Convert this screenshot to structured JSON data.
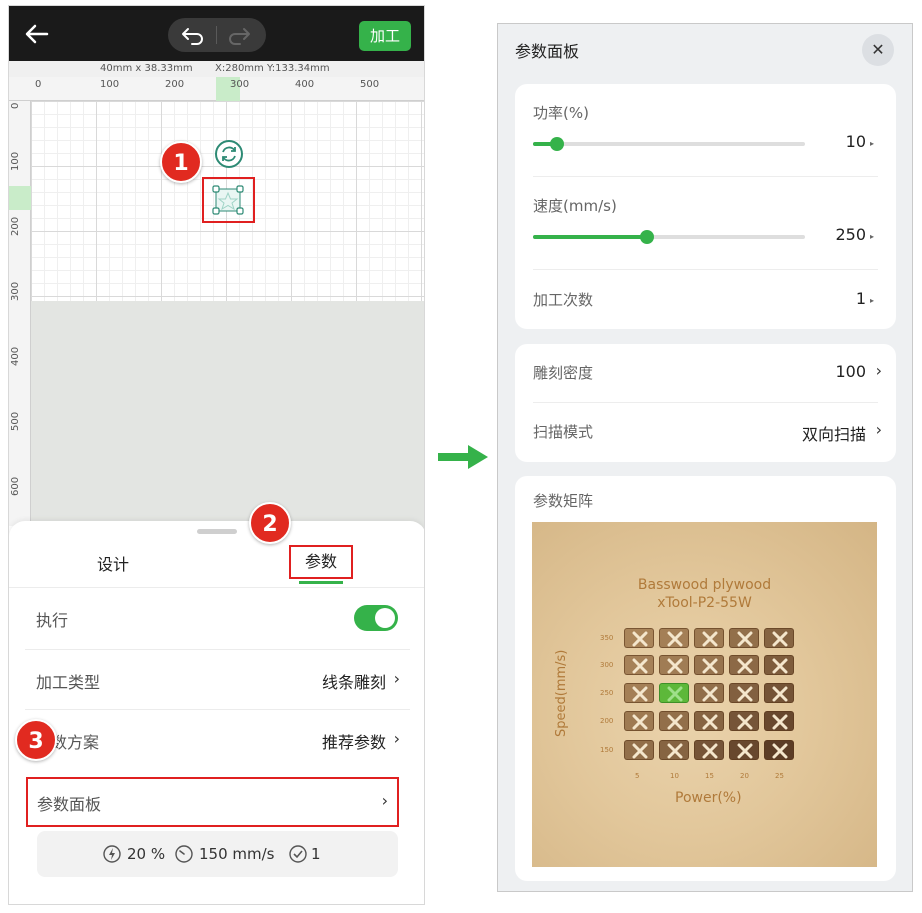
{
  "left": {
    "toolbar": {
      "process_label": "加工"
    },
    "dims": {
      "size": "40mm x 38.33mm",
      "pos": "X:280mm Y:133.34mm"
    },
    "ruler_top": [
      "0",
      "100",
      "200",
      "300",
      "400",
      "500"
    ],
    "ruler_left": [
      "0",
      "100",
      "200",
      "300",
      "400",
      "500",
      "600"
    ],
    "badges": [
      "1",
      "2",
      "3"
    ],
    "tabs": {
      "design": "设计",
      "params": "参数"
    },
    "rows": {
      "execute": "执行",
      "process_type": "加工类型",
      "process_type_value": "线条雕刻",
      "param_scheme": "数方案",
      "param_scheme_value": "推荐参数",
      "param_panel": "参数面板"
    },
    "summary": {
      "power": "20 %",
      "speed": "150 mm/s",
      "passes": "1"
    },
    "execute_on": true
  },
  "right": {
    "title": "参数面板",
    "power": {
      "label": "功率(%)",
      "value": "10",
      "fraction": 0.09
    },
    "speed": {
      "label": "速度(mm/s)",
      "value": "250",
      "fraction": 0.42
    },
    "passes": {
      "label": "加工次数",
      "value": "1"
    },
    "density": {
      "label": "雕刻密度",
      "value": "100"
    },
    "scan": {
      "label": "扫描模式",
      "value": "双向扫描"
    },
    "matrix": {
      "label": "参数矩阵",
      "photo_title1": "Basswood plywood",
      "photo_title2": "xTool-P2-55W",
      "ylabel": "Speed(mm/s)",
      "xlabel": "Power(%)",
      "y_ticks": [
        "350",
        "300",
        "250",
        "200",
        "150"
      ],
      "x_ticks": [
        "5",
        "10",
        "15",
        "20",
        "25"
      ]
    }
  },
  "colors": {
    "accent": "#35b24a",
    "highlight": "#e02020",
    "dark": "#1a1a1a"
  }
}
